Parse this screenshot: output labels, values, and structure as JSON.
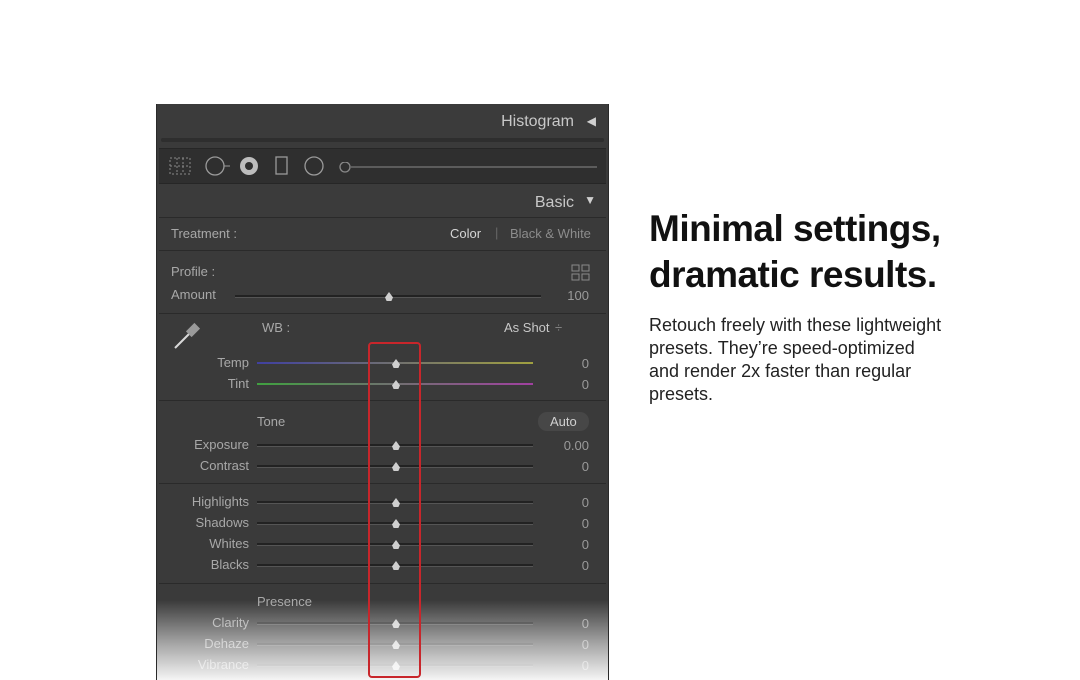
{
  "panel": {
    "histogram_title": "Histogram",
    "basic_title": "Basic",
    "treatment": {
      "label": "Treatment :",
      "color": "Color",
      "divider": "|",
      "bw": "Black & White"
    },
    "profile": {
      "label": "Profile :",
      "amount_label": "Amount",
      "amount_value": "100"
    },
    "wb": {
      "label": "WB :",
      "value": "As Shot",
      "arrows": "÷"
    },
    "sliders": {
      "temp": {
        "label": "Temp",
        "value": "0"
      },
      "tint": {
        "label": "Tint",
        "value": "0"
      },
      "exposure": {
        "label": "Exposure",
        "value": "0.00"
      },
      "contrast": {
        "label": "Contrast",
        "value": "0"
      },
      "highlights": {
        "label": "Highlights",
        "value": "0"
      },
      "shadows": {
        "label": "Shadows",
        "value": "0"
      },
      "whites": {
        "label": "Whites",
        "value": "0"
      },
      "blacks": {
        "label": "Blacks",
        "value": "0"
      },
      "clarity": {
        "label": "Clarity",
        "value": "0"
      },
      "dehaze": {
        "label": "Dehaze",
        "value": "0"
      },
      "vibrance": {
        "label": "Vibrance",
        "value": "0"
      }
    },
    "tone": {
      "label": "Tone",
      "auto": "Auto"
    },
    "presence": {
      "label": "Presence"
    },
    "icons": [
      "grid-crop-icon",
      "spot-removal-icon",
      "red-eye-icon",
      "graduated-filter-icon",
      "radial-filter-icon",
      "adjustment-brush-icon"
    ]
  },
  "marketing": {
    "headline_line1": "Minimal settings,",
    "headline_line2": "dramatic results.",
    "body": "Retouch freely with these lightweight presets. They’re speed-optimized and render 2x faster than regular presets."
  },
  "colors": {
    "highlight_box": "#c8262b",
    "panel_bg": "#3a3a3a"
  }
}
